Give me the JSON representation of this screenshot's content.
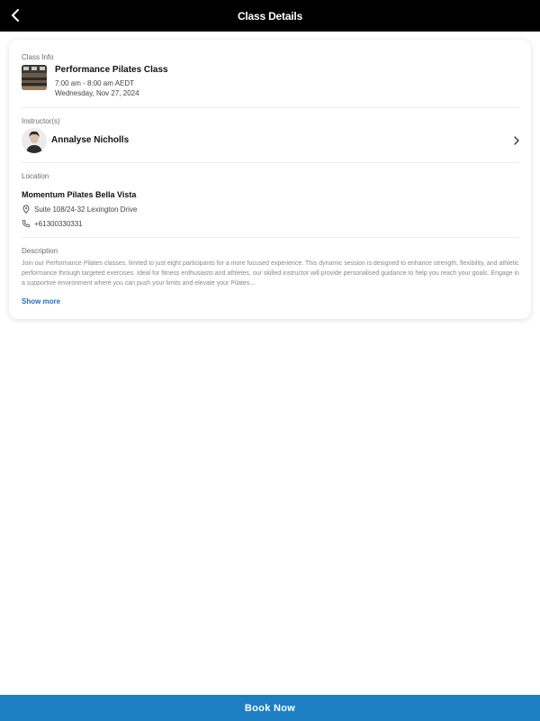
{
  "header": {
    "title": "Class Details",
    "back_icon": "chevron-left-icon"
  },
  "class_info": {
    "label": "Class Info",
    "name": "Performance Pilates Class",
    "time": "7:00 am - 8:00 am AEDT",
    "date": "Wednesday, Nov 27, 2024"
  },
  "instructor": {
    "label": "Instructor(s)",
    "name": "Annalyse Nicholls",
    "chevron_icon": "chevron-right-icon"
  },
  "location": {
    "label": "Location",
    "name": "Momentum Pilates Bella Vista",
    "address": "Suite 108/24-32 Lexington Drive",
    "phone": "+61300330331",
    "address_icon": "map-pin-icon",
    "phone_icon": "phone-icon"
  },
  "description": {
    "label": "Description",
    "text": "Join our Performance Pilates classes, limited to just eight participants for a more focused experience. This dynamic session is designed to enhance strength, flexibility, and athletic performance through targeted exercises. Ideal for fitness enthusiasts and athletes, our skilled instructor will provide personalised guidance to help you reach your goals. Engage in a supportive environment where you can push your limits and elevate your Pilates...",
    "show_more": "Show more"
  },
  "footer": {
    "book_label": "Book Now"
  },
  "colors": {
    "header_bg": "#000000",
    "accent": "#1c7fc4",
    "link": "#1a6fc4"
  }
}
